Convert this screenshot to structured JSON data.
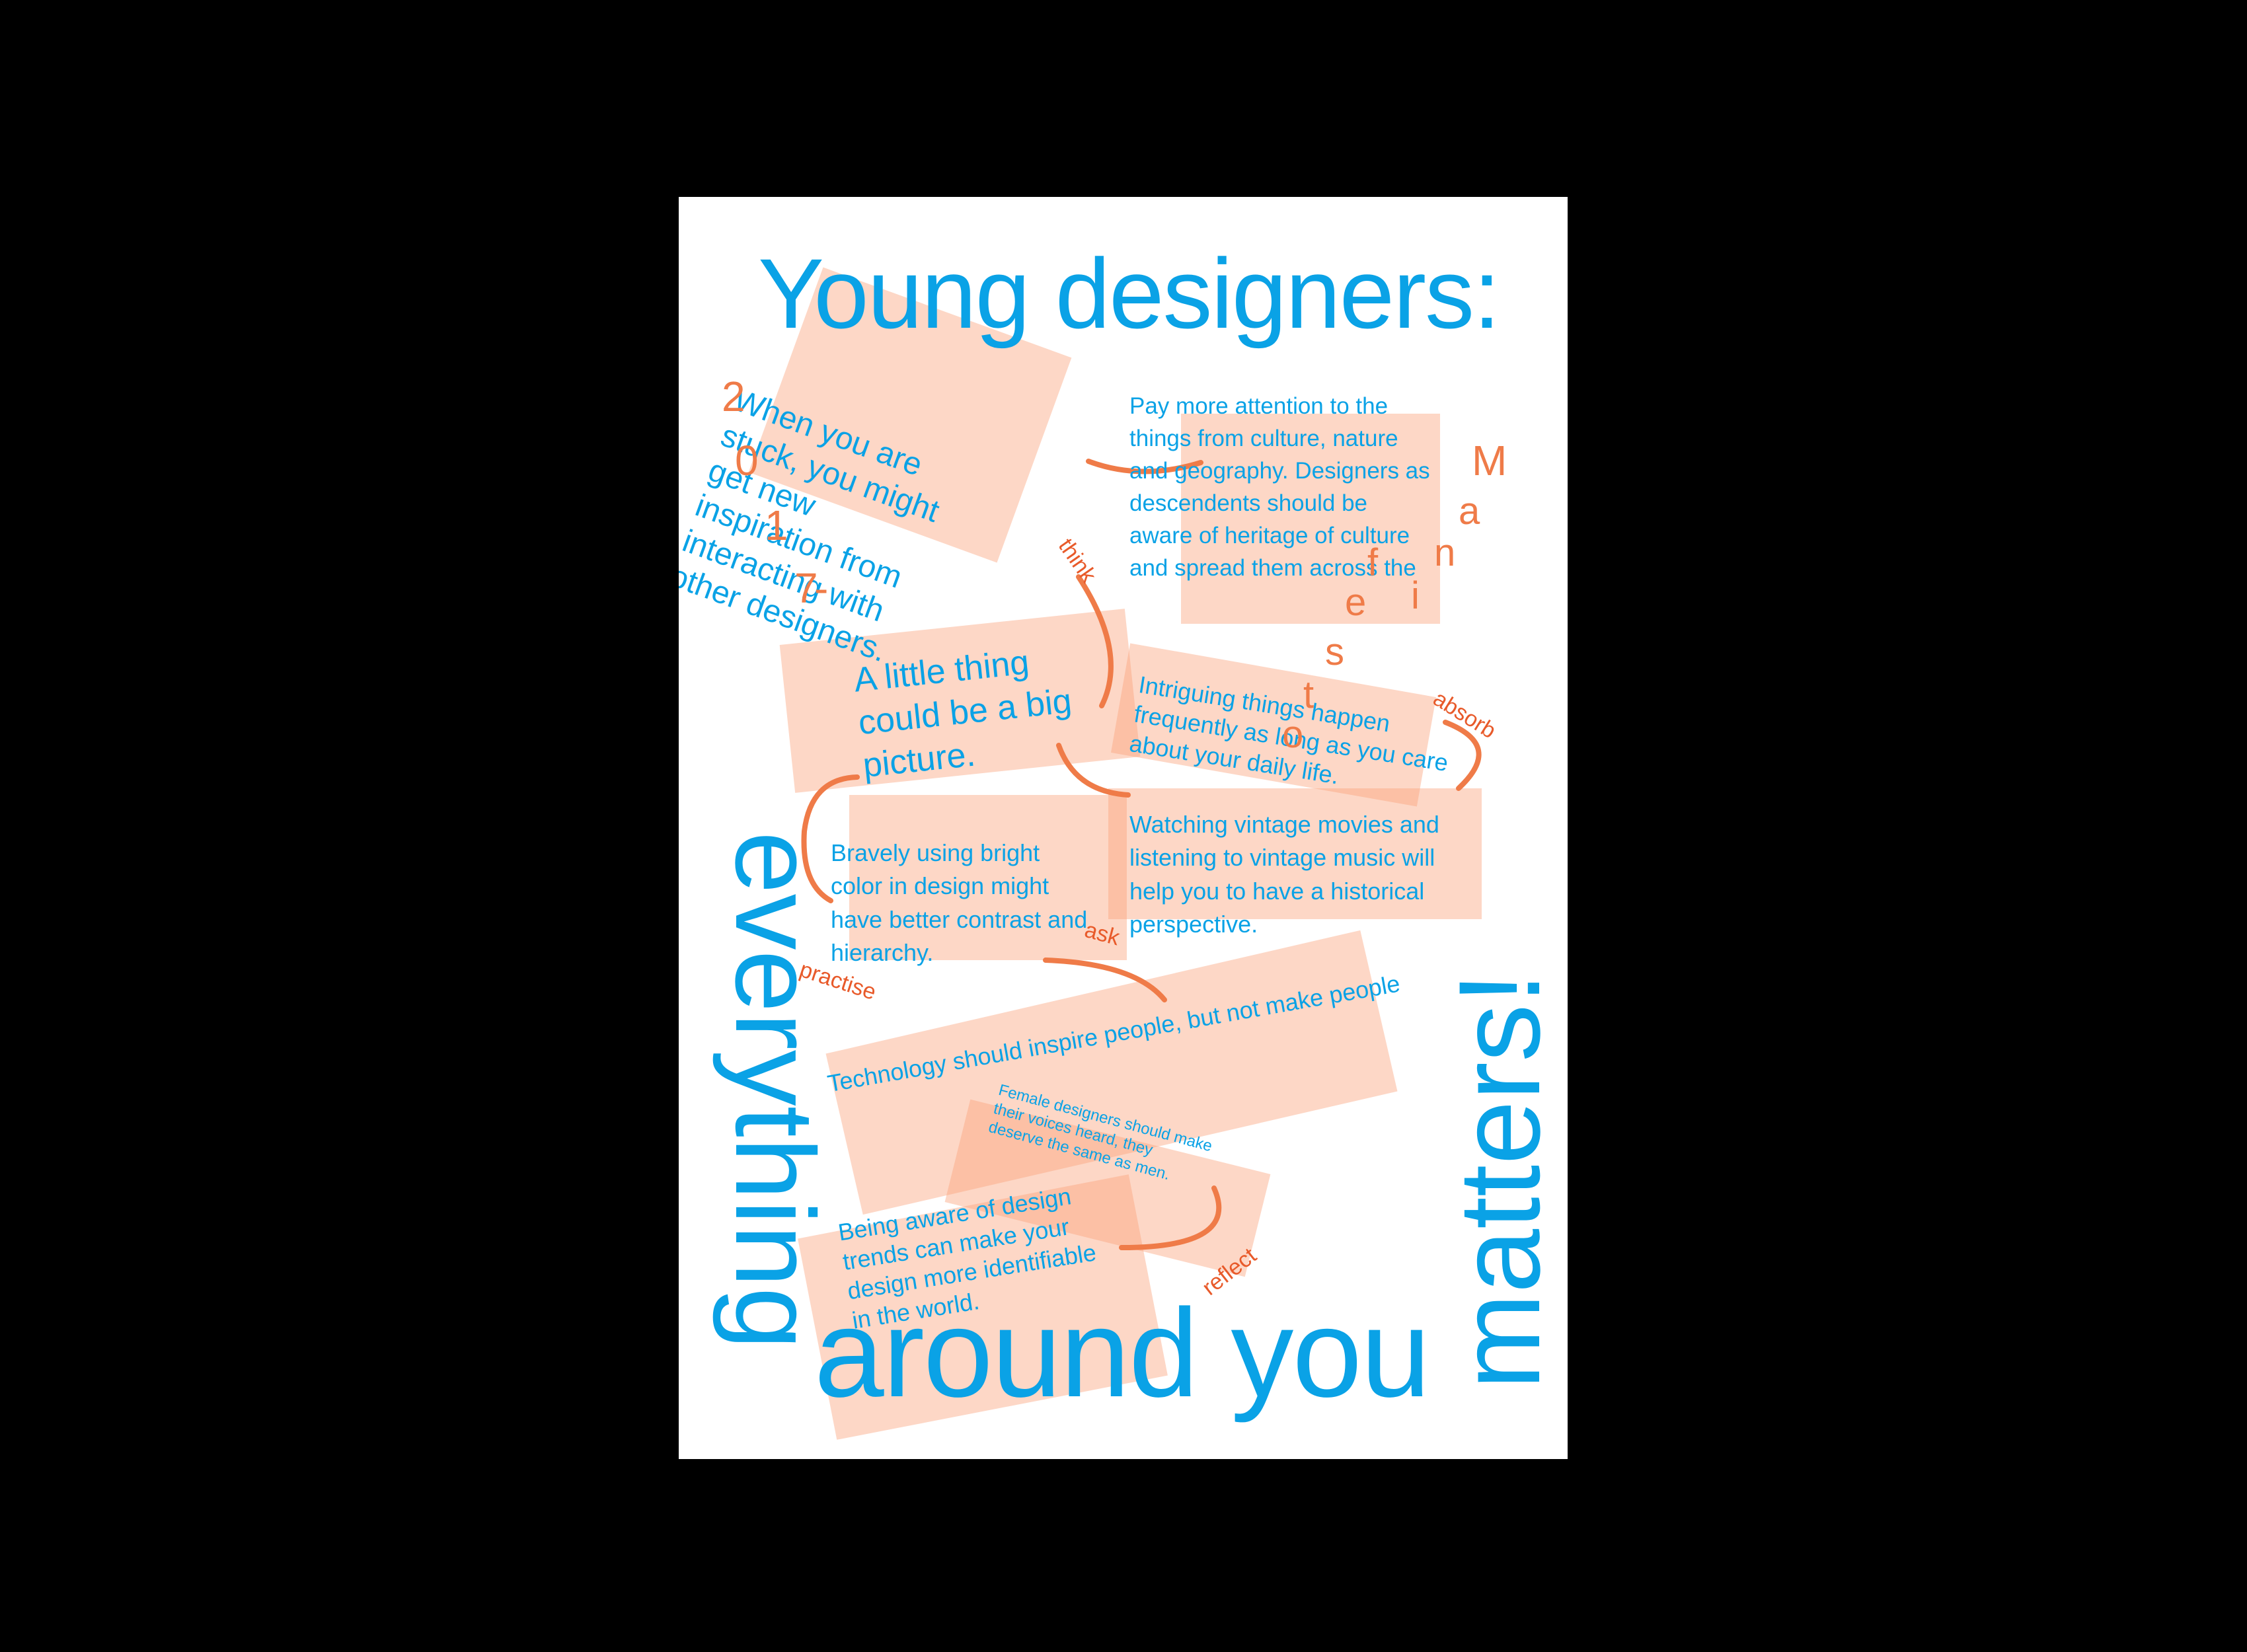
{
  "title": "Young designers:",
  "side_left": "everything",
  "bottom": "around you",
  "side_right": "matters!",
  "year_chars": [
    "2",
    "0",
    "1",
    "7",
    "-"
  ],
  "name_chars": [
    "M",
    "a",
    "n",
    "i",
    "f",
    "e",
    "s",
    "t",
    "o"
  ],
  "blocks": {
    "stuck": [
      "When you are",
      "stuck, you might",
      "get new",
      "inspiration from",
      "interacting with",
      "other designers."
    ],
    "culture": [
      "Pay more attention to the",
      "things from culture, nature",
      "and geography. Designers as",
      "descendents should be",
      "aware of heritage of culture",
      "and spread them across the"
    ],
    "little": [
      "A little thing",
      "could be a big",
      "picture."
    ],
    "intriguing": [
      "Intriguing things happen",
      "frequently as long as you care",
      "about your daily life."
    ],
    "bright": [
      "Bravely using  bright",
      "color in design might",
      "have better contrast and",
      "hierarchy."
    ],
    "vintage": [
      "Watching vintage movies and",
      "listening to vintage music will",
      "help you to have a historical",
      "perspective."
    ],
    "technology": [
      "Technology should inspire people, but not make people"
    ],
    "female": [
      "Female designers should make",
      "their voices heard, they",
      "deserve the same as men."
    ],
    "trends": [
      "Being aware of design",
      "trends can make your",
      "design more identifiable",
      "in the world."
    ]
  },
  "verbs": {
    "think": "think",
    "absorb": "absorb",
    "ask": "ask",
    "practise": "practise",
    "reflect": "reflect"
  },
  "colors": {
    "background": "#000000",
    "poster": "#ffffff",
    "blue_text": "#0aa2e6",
    "orange": "#ef7b48",
    "peach_box": "#fbcdb4"
  }
}
